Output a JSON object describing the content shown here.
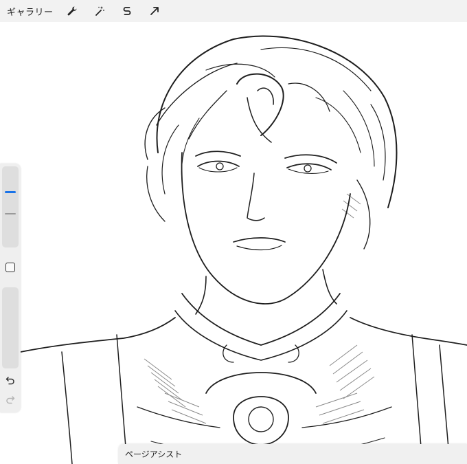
{
  "toolbar": {
    "gallery_label": "ギャラリー",
    "icons": [
      "wrench-icon",
      "magic-wand-icon",
      "selection-s-icon",
      "transform-arrow-icon"
    ]
  },
  "sidebar": {
    "brush_size_level": 0.3,
    "opacity_level": 0.6
  },
  "page_assist": {
    "label": "ページアシスト"
  },
  "colors": {
    "accent": "#1a73e8",
    "toolbar_bg": "#f2f2f2",
    "sidebar_bg": "#efefef",
    "canvas_bg": "#ffffff",
    "ink": "#222222"
  }
}
